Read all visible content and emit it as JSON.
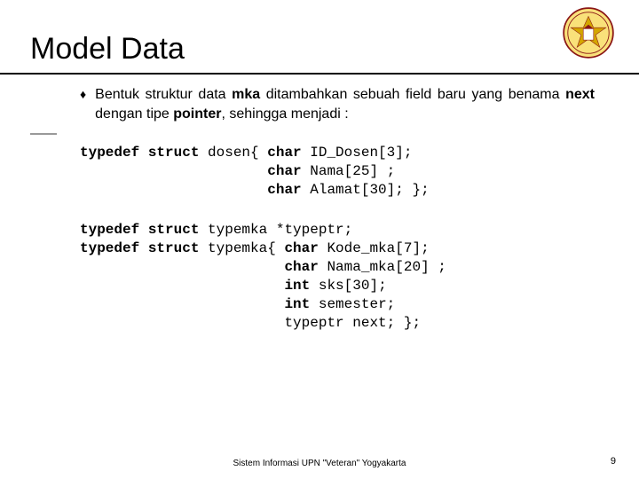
{
  "title": "Model Data",
  "bullet": {
    "marker": "♦",
    "text_parts": [
      "Bentuk struktur data ",
      "mka",
      " ditambahkan sebuah field baru yang benama ",
      "next",
      " dengan tipe ",
      "pointer",
      ", sehingga menjadi :"
    ]
  },
  "code1": {
    "l1a": "typedef struct",
    "l1b": " dosen{ ",
    "l1c": "char",
    "l1d": " ID_Dosen[3];",
    "l2a": "                      ",
    "l2b": "char",
    "l2c": " Nama[25] ;",
    "l3a": "                      ",
    "l3b": "char",
    "l3c": " Alamat[30]; };"
  },
  "code2": {
    "l1a": "typedef struct",
    "l1b": " typemka *typeptr;",
    "l2a": "typedef struct",
    "l2b": " typemka{ ",
    "l2c": "char",
    "l2d": " Kode_mka[7];",
    "l3a": "                        ",
    "l3b": "char",
    "l3c": " Nama_mka[20] ;",
    "l4a": "                        ",
    "l4b": "int",
    "l4c": " sks[30];",
    "l5a": "                        ",
    "l5b": "int",
    "l5c": " semester;",
    "l6a": "                        typeptr next; };"
  },
  "footer": "Sistem Informasi UPN \"Veteran\" Yogyakarta",
  "page": "9"
}
